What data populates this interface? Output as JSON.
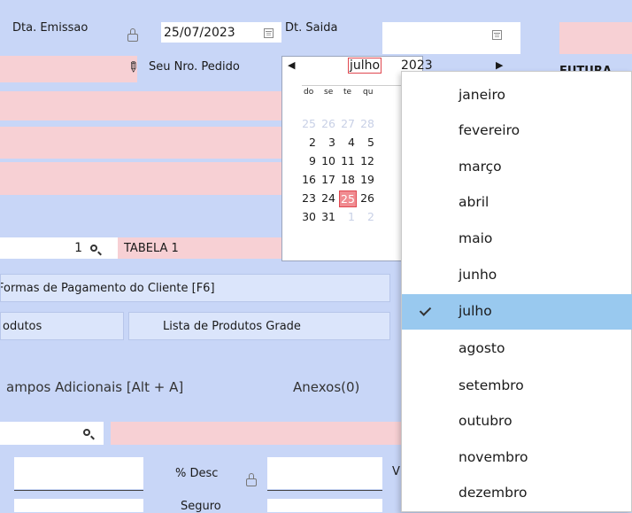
{
  "form": {
    "emissao_label": "Dta. Emissao",
    "emissao_value": "25/07/2023",
    "saida_label": "Dt. Saida",
    "pedido_label": "Seu Nro. Pedido",
    "right_label": "FUTURA",
    "tabela_value": "1",
    "tabela_name": "TABELA 1",
    "formas_pagamento": "Formas de Pagamento do Cliente [F6]",
    "produtos": "odutos",
    "lista_grade": "Lista de Produtos Grade",
    "campos_adicionais": "ampos Adicionais [Alt + A]",
    "anexos": "Anexos(0)",
    "desc_label": "% Desc",
    "seguro_label": "Seguro",
    "v_label": "V"
  },
  "calendar": {
    "month": "julho",
    "year": "2023",
    "days_of_week": [
      "do",
      "se",
      "te",
      "qu"
    ],
    "rows": [
      [
        "25",
        "26",
        "27",
        "28"
      ],
      [
        "2",
        "3",
        "4",
        "5"
      ],
      [
        "9",
        "10",
        "11",
        "12"
      ],
      [
        "16",
        "17",
        "18",
        "19"
      ],
      [
        "23",
        "24",
        "25",
        "26"
      ],
      [
        "30",
        "31",
        "1",
        "2"
      ]
    ],
    "selected_day": "25"
  },
  "month_menu": {
    "items": [
      "janeiro",
      "fevereiro",
      "março",
      "abril",
      "maio",
      "junho",
      "julho",
      "agosto",
      "setembro",
      "outubro",
      "novembro",
      "dezembro"
    ],
    "selected": "julho"
  },
  "colors": {
    "background": "#c8d6f7",
    "field_pink": "#f7d0d4",
    "selected_item": "#99c9ef",
    "today_red": "#e0474f"
  }
}
